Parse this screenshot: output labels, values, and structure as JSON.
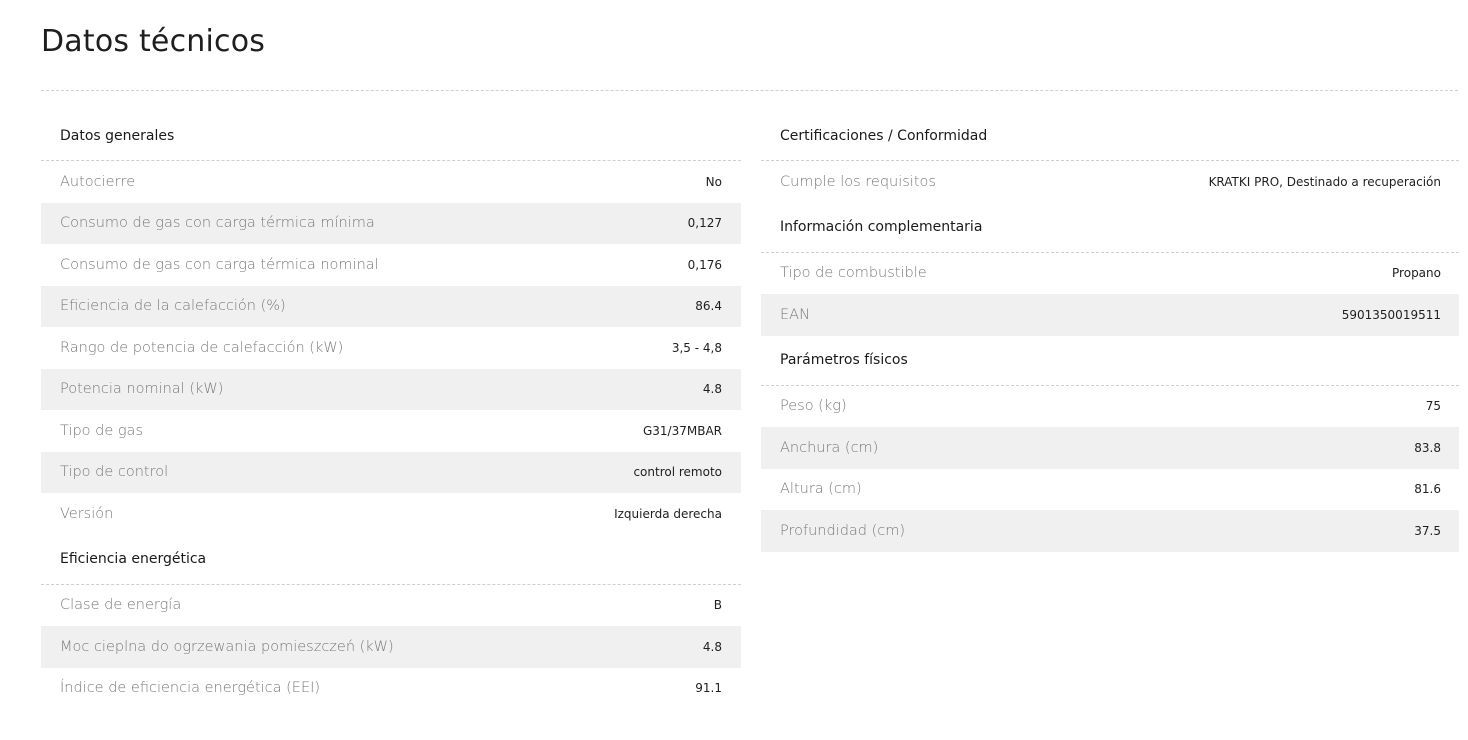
{
  "page": {
    "title": "Datos técnicos"
  },
  "left": {
    "sections": [
      {
        "heading": "Datos generales",
        "rows": [
          {
            "label": "Autocierre",
            "value": "No"
          },
          {
            "label": "Consumo de gas con carga térmica mínima",
            "value": "0,127"
          },
          {
            "label": "Consumo de gas con carga térmica nominal",
            "value": "0,176"
          },
          {
            "label": "Eficiencia de la calefacción (%)",
            "value": "86.4"
          },
          {
            "label": "Rango de potencia de calefacción (kW)",
            "value": "3,5 - 4,8"
          },
          {
            "label": "Potencia nominal (kW)",
            "value": "4.8"
          },
          {
            "label": "Tipo de gas",
            "value": "G31/37MBAR"
          },
          {
            "label": "Tipo de control",
            "value": "control remoto"
          },
          {
            "label": "Versión",
            "value": "Izquierda derecha"
          }
        ]
      },
      {
        "heading": "Eficiencia energética",
        "rows": [
          {
            "label": "Clase de energía",
            "value": "B"
          },
          {
            "label": "Moc cieplna do ogrzewania pomieszczeń (kW)",
            "value": "4.8"
          },
          {
            "label": "Índice de eficiencia energética (EEI)",
            "value": "91.1"
          }
        ]
      }
    ]
  },
  "right": {
    "sections": [
      {
        "heading": "Certificaciones / Conformidad",
        "rows": [
          {
            "label": "Cumple los requisitos",
            "value": "KRATKI PRO, Destinado a recuperación"
          }
        ]
      },
      {
        "heading": "Información complementaria",
        "rows": [
          {
            "label": "Tipo de combustible",
            "value": "Propano"
          },
          {
            "label": "EAN",
            "value": "5901350019511"
          }
        ]
      },
      {
        "heading": "Parámetros físicos",
        "rows": [
          {
            "label": "Peso (kg)",
            "value": "75"
          },
          {
            "label": "Anchura (cm)",
            "value": "83.8"
          },
          {
            "label": "Altura (cm)",
            "value": "81.6"
          },
          {
            "label": "Profundidad (cm)",
            "value": "37.5"
          }
        ]
      }
    ]
  },
  "colors": {
    "row_shade": "#f0f0f0",
    "divider": "#cfcfcf",
    "label": "#7a7a7a"
  }
}
